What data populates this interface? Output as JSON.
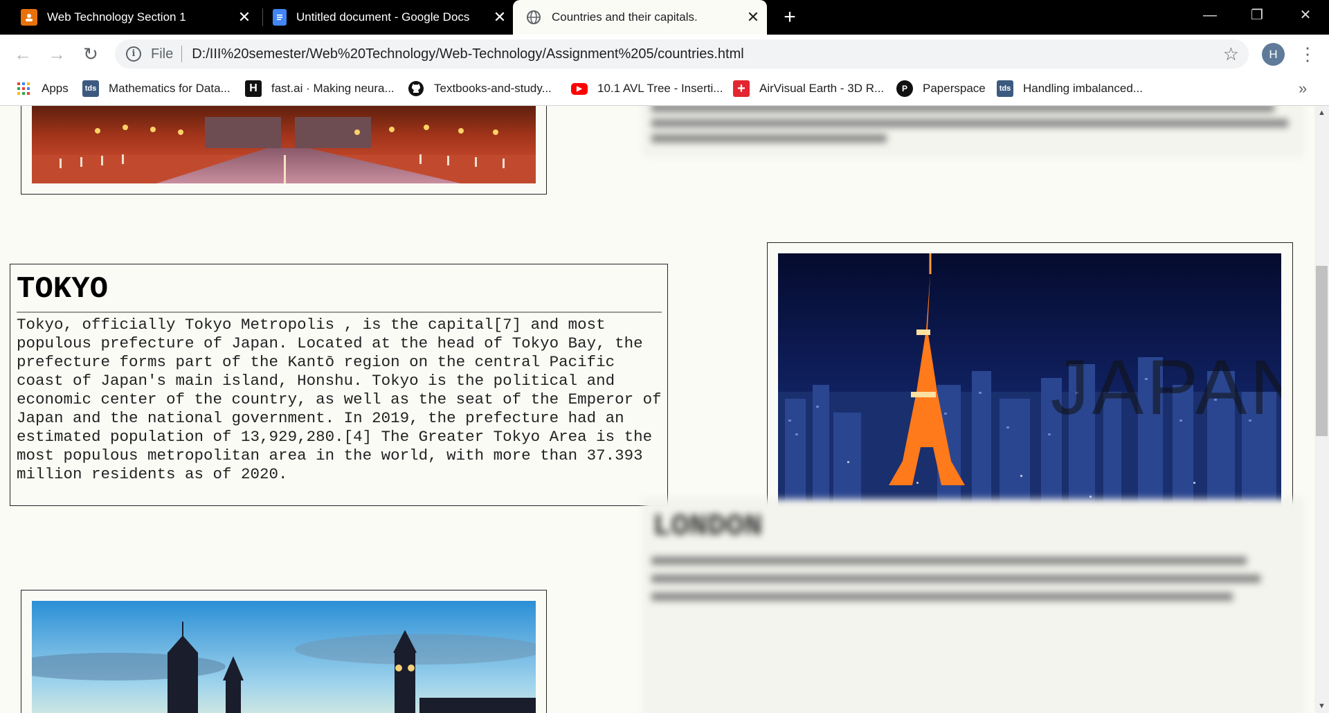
{
  "tabs": [
    {
      "title": "Web Technology Section 1",
      "close": "✕"
    },
    {
      "title": "Untitled document - Google Docs",
      "close": "✕"
    },
    {
      "title": "Countries and their capitals.",
      "close": "✕"
    }
  ],
  "new_tab": "+",
  "window_controls": {
    "minimize": "—",
    "restore": "❐",
    "close": "✕"
  },
  "toolbar": {
    "back": "←",
    "forward": "→",
    "reload": "↻",
    "site_info": "i",
    "scheme_label": "File",
    "url": "D:/III%20semester/Web%20Technology/Web-Technology/Assignment%205/countries.html",
    "bookmark_star": "☆",
    "profile_initial": "H",
    "menu": "⋮"
  },
  "bookmarks": [
    {
      "label": "Apps",
      "icon": "apps-grid-icon"
    },
    {
      "label": "Mathematics for Data...",
      "icon": "tds-icon",
      "icon_text": "tds"
    },
    {
      "label": "fast.ai · Making neura...",
      "icon": "fastai-icon",
      "icon_text": "H"
    },
    {
      "label": "Textbooks-and-study...",
      "icon": "github-icon"
    },
    {
      "label": "10.1 AVL Tree - Inserti...",
      "icon": "youtube-icon",
      "icon_text": "▶"
    },
    {
      "label": "AirVisual Earth - 3D R...",
      "icon": "airvisual-icon",
      "icon_text": "+"
    },
    {
      "label": "Paperspace",
      "icon": "paperspace-icon",
      "icon_text": "P"
    },
    {
      "label": "Handling imbalanced...",
      "icon": "tds-icon",
      "icon_text": "tds"
    }
  ],
  "bookmarks_overflow": "»",
  "content": {
    "city_title": "TOKYO",
    "city_text": "Tokyo, officially Tokyo Metropolis , is the capital[7] and most populous prefecture of Japan. Located at the head of Tokyo Bay, the prefecture forms part of the Kantō region on the central Pacific coast of Japan's main island, Honshu. Tokyo is the political and economic center of the country, as well as the seat of the Emperor of Japan and the national government. In 2019, the prefecture had an estimated population of 13,929,280.[4] The Greater Tokyo Area is the most populous metropolitan area in the world, with more than 37.393 million residents as of 2020.",
    "photo_overlay": "JAPAN",
    "blurred_heading": "LONDON"
  },
  "colors": {
    "tab_strip": "#000000",
    "page_background": "#fbfbf6",
    "scroll_thumb": "#c1c1c1"
  }
}
